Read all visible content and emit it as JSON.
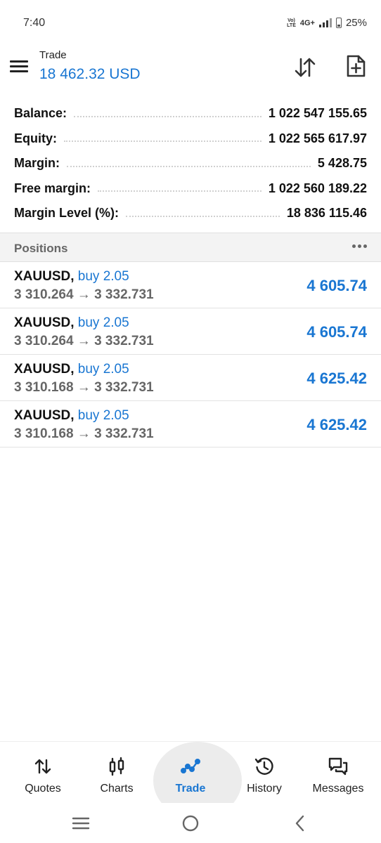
{
  "status_bar": {
    "time": "7:40",
    "volte": "Vo) LTE",
    "network": "4G+",
    "battery": "25%"
  },
  "header": {
    "title": "Trade",
    "balance_line": "18 462.32 USD",
    "sort_icon": "sort-arrows-icon",
    "new_order_icon": "new-document-icon"
  },
  "summary": [
    {
      "label": "Balance:",
      "value": "1 022 547 155.65"
    },
    {
      "label": "Equity:",
      "value": "1 022 565 617.97"
    },
    {
      "label": "Margin:",
      "value": "5 428.75"
    },
    {
      "label": "Free margin:",
      "value": "1 022 560 189.22"
    },
    {
      "label": "Margin Level (%):",
      "value": "18 836 115.46"
    }
  ],
  "positions": {
    "title": "Positions",
    "items": [
      {
        "symbol": "XAUUSD,",
        "side": "buy 2.05",
        "prices": "3 310.264 → 3 332.731",
        "profit": "4 605.74"
      },
      {
        "symbol": "XAUUSD,",
        "side": "buy 2.05",
        "prices": "3 310.264 → 3 332.731",
        "profit": "4 605.74"
      },
      {
        "symbol": "XAUUSD,",
        "side": "buy 2.05",
        "prices": "3 310.168 → 3 332.731",
        "profit": "4 625.42"
      },
      {
        "symbol": "XAUUSD,",
        "side": "buy 2.05",
        "prices": "3 310.168 → 3 332.731",
        "profit": "4 625.42"
      }
    ]
  },
  "bottom_nav": {
    "items": [
      {
        "label": "Quotes",
        "icon": "quotes-arrows-icon"
      },
      {
        "label": "Charts",
        "icon": "candlestick-icon"
      },
      {
        "label": "Trade",
        "icon": "trend-line-icon",
        "active": true
      },
      {
        "label": "History",
        "icon": "history-clock-icon"
      },
      {
        "label": "Messages",
        "icon": "chat-bubbles-icon"
      }
    ]
  },
  "colors": {
    "accent": "#1976d2",
    "text": "#111111",
    "muted": "#666666",
    "section_bg": "#f3f3f3"
  }
}
